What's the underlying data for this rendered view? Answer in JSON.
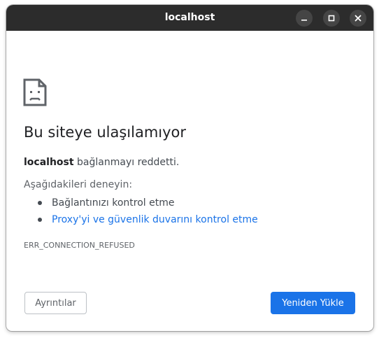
{
  "window": {
    "title": "localhost",
    "controls": [
      "minimize",
      "maximize",
      "close"
    ]
  },
  "error_page": {
    "icon": "sad-page-icon",
    "heading": "Bu siteye ulaşılamıyor",
    "host": "localhost",
    "message": " bağlanmayı reddetti.",
    "try_label": "Aşağıdakileri deneyin:",
    "suggestions": [
      {
        "label": "Bağlantınızı kontrol etme",
        "is_link": false
      },
      {
        "label": "Proxy'yi ve güvenlik duvarını kontrol etme",
        "is_link": true
      }
    ],
    "error_code": "ERR_CONNECTION_REFUSED"
  },
  "buttons": {
    "details_label": "Ayrıntılar",
    "reload_label": "Yeniden Yükle"
  },
  "colors": {
    "titlebar": "#2c2c2c",
    "link": "#1a73e8",
    "primary_button": "#1a73e8"
  }
}
